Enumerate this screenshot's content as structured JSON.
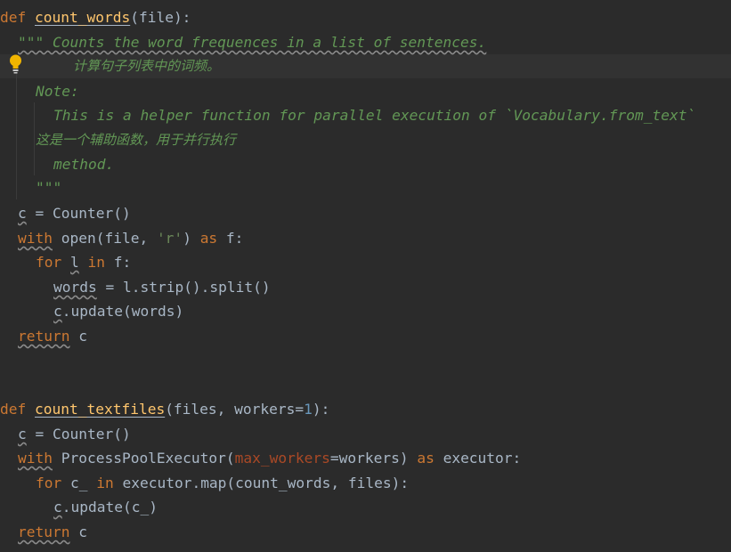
{
  "code": {
    "l1": {
      "def": "def",
      "name": "count_words",
      "open": "(",
      "arg": "file",
      "close": "):"
    },
    "l2": {
      "text": "\"\"\" Counts the word frequences in a list of sentences."
    },
    "l3": {
      "text": "计算句子列表中的词频。"
    },
    "l4": {
      "text": "Note:"
    },
    "l5": {
      "text": "This is a helper function for parallel execution of `Vocabulary.from_text`"
    },
    "l6": {
      "text": "这是一个辅助函数，用于并行执行"
    },
    "l7": {
      "text": "method."
    },
    "l8": {
      "text": "\"\"\""
    },
    "l9": {
      "var": "c",
      "rest": " = Counter()"
    },
    "l10": {
      "with": "with",
      "call": " open(file, ",
      "str": "'r'",
      "close": ") ",
      "as": "as",
      "tail": " f:"
    },
    "l11": {
      "for": "for",
      "var": "l",
      "in": "in",
      "tail": " f:"
    },
    "l12": {
      "var": "words",
      "rest": " = l.strip().split()"
    },
    "l13": {
      "var": "c",
      "rest": ".update(words)"
    },
    "l14": {
      "ret": "return",
      "tail": " c"
    },
    "l15": {
      "def": "def",
      "name": "count_textfiles",
      "open": "(files, workers=",
      "num": "1",
      "close": "):"
    },
    "l16": {
      "var": "c",
      "rest": " = Counter()"
    },
    "l17": {
      "with": "with",
      "call": " ProcessPoolExecutor(",
      "kwarg": "max_workers",
      "eq": "=workers) ",
      "as": "as",
      "tail": " executor:"
    },
    "l18": {
      "for": "for",
      "var": " c_ ",
      "in": "in",
      "tail": " executor.map(count_words, files):"
    },
    "l19": {
      "var": "c",
      "rest": ".update(c_)"
    },
    "l20": {
      "ret": "return",
      "tail": " c"
    }
  },
  "icons": {
    "bulb": "lightbulb-icon"
  },
  "colors": {
    "background": "#2b2b2b",
    "keyword": "#cc7832",
    "function": "#ffc66d",
    "docstring": "#629755",
    "string": "#6a8759",
    "number": "#6897bb",
    "text": "#a9b7c6"
  }
}
